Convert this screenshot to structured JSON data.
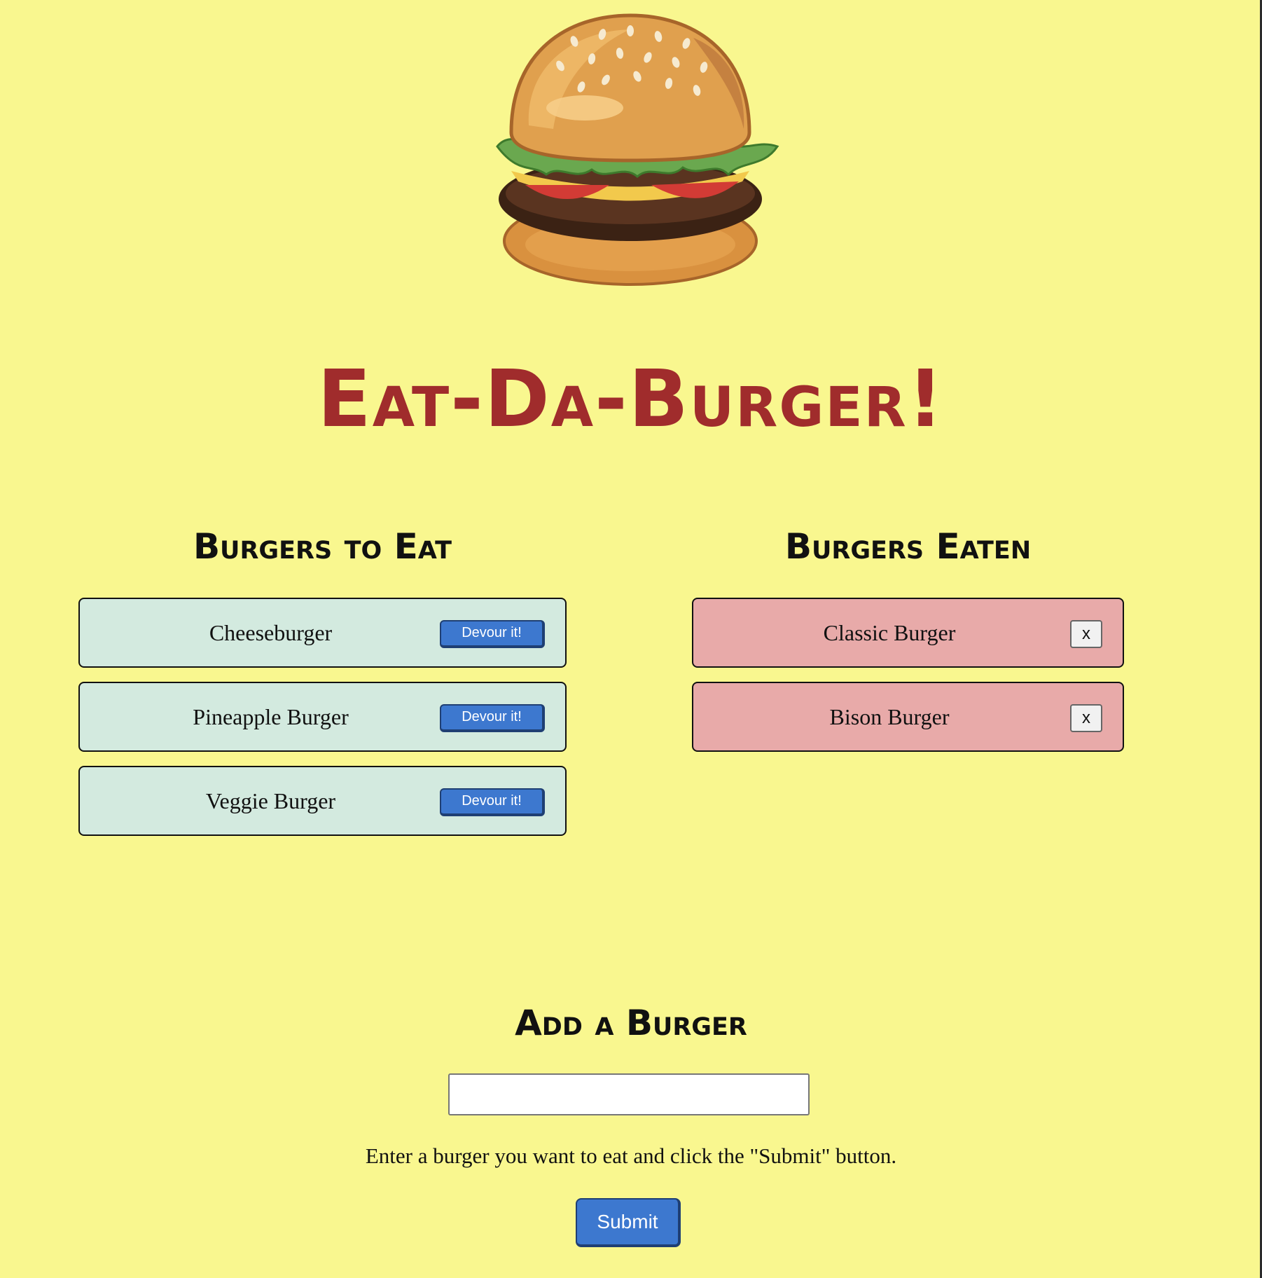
{
  "header": {
    "title": "Eat-Da-Burger!"
  },
  "hero_image": {
    "icon": "burger-icon"
  },
  "to_eat": {
    "heading": "Burgers to Eat",
    "items": [
      {
        "name": "Cheeseburger",
        "button": "Devour it!"
      },
      {
        "name": "Pineapple Burger",
        "button": "Devour it!"
      },
      {
        "name": "Veggie Burger",
        "button": "Devour it!"
      }
    ]
  },
  "eaten": {
    "heading": "Burgers Eaten",
    "items": [
      {
        "name": "Classic Burger",
        "button": "x"
      },
      {
        "name": "Bison Burger",
        "button": "x"
      }
    ]
  },
  "add_form": {
    "heading": "Add a Burger",
    "input_value": "",
    "instructions": "Enter a burger you want to eat and click the \"Submit\" button.",
    "submit_label": "Submit"
  },
  "colors": {
    "background": "#f9f78f",
    "title": "#a02c2c",
    "to_eat_card": "#d3eadf",
    "eaten_card": "#e8aaa9",
    "button": "#3d78cf"
  }
}
